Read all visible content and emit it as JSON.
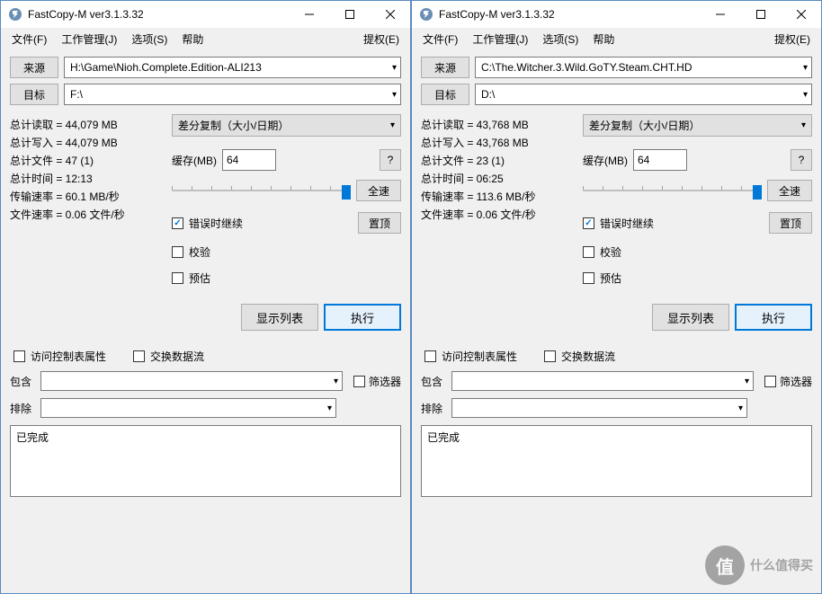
{
  "app": {
    "title": "FastCopy-M ver3.1.3.32"
  },
  "menu": {
    "file": "文件(F)",
    "job": "工作管理(J)",
    "option": "选项(S)",
    "help": "帮助",
    "auth": "提权(E)"
  },
  "labels": {
    "source": "来源",
    "dest": "目标",
    "buffer": "缓存(MB)",
    "q": "?",
    "fullspeed": "全速",
    "err_continue": "错误时继续",
    "verify": "校验",
    "estimate": "预估",
    "topmost": "置顶",
    "showlist": "显示列表",
    "execute": "执行",
    "acl": "访问控制表属性",
    "altstream": "交换数据流",
    "include": "包含",
    "exclude": "排除",
    "filter": "筛选器",
    "mode": "差分复制（大小/日期）"
  },
  "left": {
    "source": "H:\\Game\\Nioh.Complete.Edition-ALI213",
    "dest": "F:\\",
    "buffer": "64",
    "stats": {
      "read": "总计读取 = 44,079 MB",
      "write": "总计写入 = 44,079 MB",
      "files": "总计文件 = 47 (1)",
      "time": "总计时间 = 12:13",
      "rate": "传输速率 = 60.1 MB/秒",
      "frate": "文件速率 = 0.06 文件/秒"
    },
    "log": "已完成"
  },
  "right": {
    "source": "C:\\The.Witcher.3.Wild.GoTY.Steam.CHT.HD",
    "dest": "D:\\",
    "buffer": "64",
    "stats": {
      "read": "总计读取 = 43,768 MB",
      "write": "总计写入 = 43,768 MB",
      "files": "总计文件 = 23 (1)",
      "time": "总计时间 = 06:25",
      "rate": "传输速率 = 113.6 MB/秒",
      "frate": "文件速率 = 0.06 文件/秒"
    },
    "log": "已完成"
  },
  "watermark": {
    "icon": "值",
    "text": "什么值得买"
  }
}
